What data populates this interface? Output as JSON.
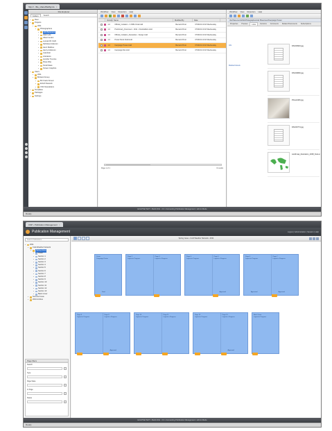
{
  "shot1": {
    "window_tab": "http://.../file_share/fileMgr.do",
    "tree": {
      "header": "File Explorer",
      "tabs": [
        "Folders",
        "Search"
      ],
      "items": [
        {
          "label": "Root",
          "depth": 0
        },
        {
          "label": "Projects",
          "depth": 0
        },
        {
          "label": "2011",
          "depth": 1
        },
        {
          "label": "Photographers",
          "depth": 2
        },
        {
          "label": "Ad Placement",
          "depth": 3,
          "selected": true
        },
        {
          "label": "Alain Lefe",
          "depth": 3
        },
        {
          "label": "Albert Gurlen",
          "depth": 3
        },
        {
          "label": "Leonard R. Dahl",
          "depth": 3
        },
        {
          "label": "Nicholas Anderson",
          "depth": 3
        },
        {
          "label": "Henri Mathieu",
          "depth": 3
        },
        {
          "label": "Henry Anderson",
          "depth": 3
        },
        {
          "label": "Cold Fish",
          "depth": 3
        },
        {
          "label": "Litterature",
          "depth": 3
        },
        {
          "label": "Jennifer Tremine",
          "depth": 3
        },
        {
          "label": "Rose Alba",
          "depth": 3
        },
        {
          "label": "Small Ideas",
          "depth": 3
        },
        {
          "label": "Screen Graphics",
          "depth": 3
        },
        {
          "label": "Users",
          "depth": 0
        },
        {
          "label": "2011",
          "depth": 1
        },
        {
          "label": "Brinland Group",
          "depth": 1
        },
        {
          "label": "BC Frank Stroud",
          "depth": 2
        },
        {
          "label": "ECHO Network",
          "depth": 2
        },
        {
          "label": "CNC Newsletters",
          "depth": 2
        },
        {
          "label": "Templates",
          "depth": 0
        },
        {
          "label": "Packages",
          "depth": 0
        },
        {
          "label": "Settings",
          "depth": 0
        }
      ]
    },
    "list": {
      "menu": [
        "Workflow",
        "View",
        "Retention",
        "Help"
      ],
      "columns": [
        "",
        "Version",
        "Name",
        "Modified By",
        "Date"
      ],
      "rows": [
        {
          "version": "1.0",
          "name": "Official_Invitation - C.0961 Final.indd",
          "modified_by": "Bernard Prost",
          "date": "07/09/12 10:16 Wednesday",
          "icon": "indd"
        },
        {
          "version": "1.0",
          "name": "Preliminary_Document - 2011 - Final Edition.indd",
          "modified_by": "Bernard Prost",
          "date": "07/09/12 10:16 Wednesday",
          "icon": "indd"
        },
        {
          "version": "1.0",
          "name": "Official_Invitation_Newsletter - Design.indd",
          "modified_by": "Bernard Prost",
          "date": "07/09/12 10:16 Wednesday",
          "icon": "indd"
        },
        {
          "version": "1.0",
          "name": "Poster Mock Draft.indd",
          "modified_by": "Bernard Prost",
          "date": "07/09/12 10:16 Wednesday",
          "icon": "indd"
        },
        {
          "version": "1.0",
          "name": "Campaign Poster.indd",
          "modified_by": "Bernard Prost",
          "date": "07/09/12 10:16 Wednesday",
          "icon": "indd",
          "selected": true
        },
        {
          "version": "1.0",
          "name": "Campaign Rel.indd",
          "modified_by": "Bernard Prost",
          "date": "07/09/12 10:16 Wednesday",
          "icon": "indd"
        }
      ],
      "footer_left": "Page 1 of 1",
      "footer_right": "6 results"
    },
    "preview": {
      "menu": [
        "Workflow",
        "View",
        "Retention",
        "Help"
      ],
      "path": "/Ad Placement/2011/Photographers/Ad Placement/Campaign Poster",
      "tabs": [
        "Properties",
        "Preview",
        "Links",
        "Versions",
        "Comments",
        "Related Documents",
        "Subscriptions"
      ],
      "side_links": [
        "Info",
        "Related Assets"
      ],
      "thumbs": [
        {
          "name": "DSC00923.jpg",
          "kind": "doc"
        },
        {
          "name": "DSC00826.jpg",
          "kind": "doc"
        },
        {
          "name": "Photo4406.jpg",
          "kind": "photo"
        },
        {
          "name": "DSC00774.jpg",
          "kind": "doc"
        },
        {
          "name": "worldmap_illustration_2008_final.ai",
          "kind": "map"
        }
      ]
    },
    "footer": "ECLIPSE TEXT • Build 2011 - 3.3 • Connecting Publication Management • Admin Mode",
    "status": "Ready"
  },
  "shot2": {
    "window_tab": "CSP • Publication Management",
    "app_title": "Publication Management",
    "header_right": "Logout | Administration | Session | Help",
    "search_placeholder": "Search Publications",
    "tree": [
      {
        "label": "2011",
        "depth": 0
      },
      {
        "label": "Cold Weather Network",
        "depth": 1
      },
      {
        "label": "Spring Issue",
        "depth": 2,
        "selected": true
      },
      {
        "label": "Cover",
        "depth": 3
      },
      {
        "label": "Section 1",
        "depth": 3
      },
      {
        "label": "Section 2",
        "depth": 3
      },
      {
        "label": "Section 3",
        "depth": 3
      },
      {
        "label": "Section 4",
        "depth": 3
      },
      {
        "label": "Section 5",
        "depth": 3
      },
      {
        "label": "Section 6",
        "depth": 3
      },
      {
        "label": "Section 7",
        "depth": 3
      },
      {
        "label": "Section 8",
        "depth": 3
      },
      {
        "label": "Section 9",
        "depth": 3
      },
      {
        "label": "Section 10",
        "depth": 3
      },
      {
        "label": "Section 11",
        "depth": 3
      },
      {
        "label": "Section 12",
        "depth": 3
      },
      {
        "label": "Section 13",
        "depth": 3
      },
      {
        "label": "Back Cover",
        "depth": 3
      },
      {
        "label": "Summer Issue",
        "depth": 1
      },
      {
        "label": "2010 Archive",
        "depth": 1
      }
    ],
    "filters_title": "Page filters",
    "filters": [
      "Search",
      "Type",
      "Page State",
      "In Page",
      "Status"
    ],
    "toolbar_center": "Spring Issue • Cold Weather Network • 2011",
    "spreads_row1": [
      {
        "pages": [
          {
            "title": "Cover",
            "sub": "Campaign Poster",
            "status": "Final",
            "mark": true
          }
        ]
      },
      {
        "pages": [
          {
            "title": "Page 2",
            "sub": "Layout in Progress"
          },
          {
            "title": "Page 3",
            "sub": "Layout in Progress",
            "mark": true
          }
        ]
      },
      {
        "pages": [
          {
            "title": "Page 4",
            "sub": "Layout in Progress"
          },
          {
            "title": "Page 5",
            "sub": "Layout in Progress",
            "status": "Approved",
            "mark": true
          }
        ]
      },
      {
        "pages": [
          {
            "title": "Page 6",
            "sub": "Layout in Progress",
            "status": "Approved"
          },
          {
            "title": "Page 7",
            "sub": "Layout in Progress",
            "status": "Approved",
            "mark": true
          }
        ]
      }
    ],
    "spreads_row2": [
      {
        "pages": [
          {
            "title": "Page 8",
            "sub": "Layout in Progress",
            "mark": true
          },
          {
            "title": "Page 9",
            "sub": "Layout in Progress",
            "status": "Approved",
            "mark": true
          }
        ]
      },
      {
        "pages": [
          {
            "title": "Page 10",
            "sub": "Layout in Progress",
            "mark": true
          },
          {
            "title": "Page 11",
            "sub": "Layout in Progress",
            "mark": true
          }
        ]
      },
      {
        "pages": [
          {
            "title": "Page 12",
            "sub": "Layout in Progress",
            "mark": true
          },
          {
            "title": "Page 13",
            "sub": "Layout in Progress",
            "status": "Approved",
            "mark": true
          }
        ]
      },
      {
        "pages": [
          {
            "title": "Back Cover",
            "sub": "Layout in Progress",
            "mark": true
          }
        ]
      }
    ],
    "footer": "ECLIPSE TEXT • Build 2011 - 3.3 • Connecting Publication Management • Admin Mode",
    "status": "Ready"
  },
  "colors": {
    "page_blue": "#8fb9f0",
    "selection_orange": "#f6b046",
    "marker_orange": "#f5a623",
    "chrome_dark": "#3d4147"
  }
}
